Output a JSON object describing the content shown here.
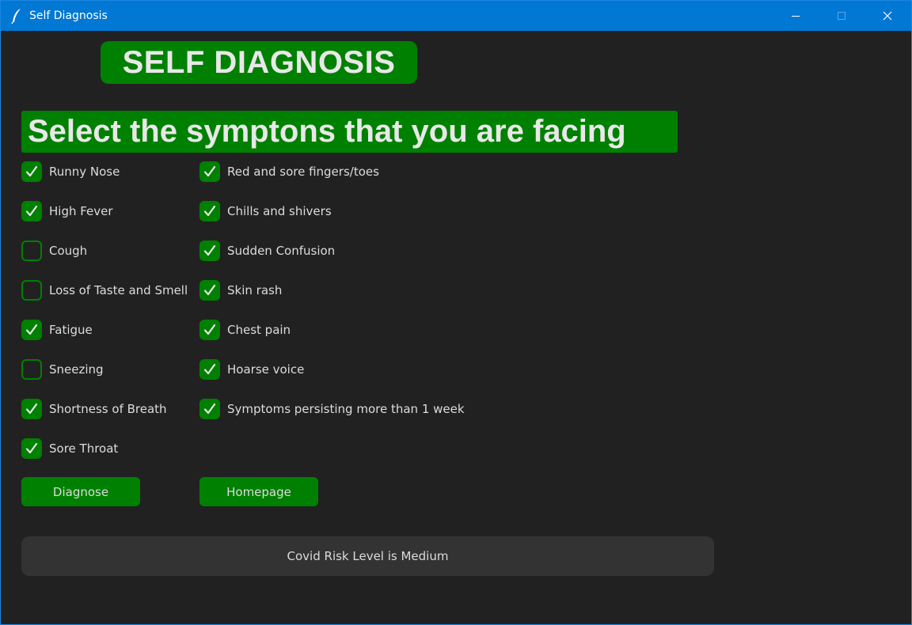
{
  "window": {
    "title": "Self Diagnosis"
  },
  "header": {
    "title": "SELF DIAGNOSIS"
  },
  "subtitle": "Select the symptons that you are facing",
  "accent_color": "#008000",
  "symptoms_left": [
    {
      "label": "Runny Nose",
      "checked": true
    },
    {
      "label": "High Fever",
      "checked": true
    },
    {
      "label": "Cough",
      "checked": false
    },
    {
      "label": "Loss of Taste and Smell",
      "checked": false
    },
    {
      "label": "Fatigue",
      "checked": true
    },
    {
      "label": "Sneezing",
      "checked": false
    },
    {
      "label": "Shortness of Breath",
      "checked": true
    },
    {
      "label": "Sore Throat",
      "checked": true
    }
  ],
  "symptoms_right": [
    {
      "label": "Red and sore fingers/toes",
      "checked": true
    },
    {
      "label": "Chills and shivers",
      "checked": true
    },
    {
      "label": "Sudden Confusion",
      "checked": true
    },
    {
      "label": "Skin rash",
      "checked": true
    },
    {
      "label": "Chest pain",
      "checked": true
    },
    {
      "label": "Hoarse voice",
      "checked": true
    },
    {
      "label": "Symptoms persisting more than 1 week",
      "checked": true
    }
  ],
  "buttons": {
    "diagnose": "Diagnose",
    "homepage": "Homepage"
  },
  "result": "Covid Risk Level is Medium"
}
